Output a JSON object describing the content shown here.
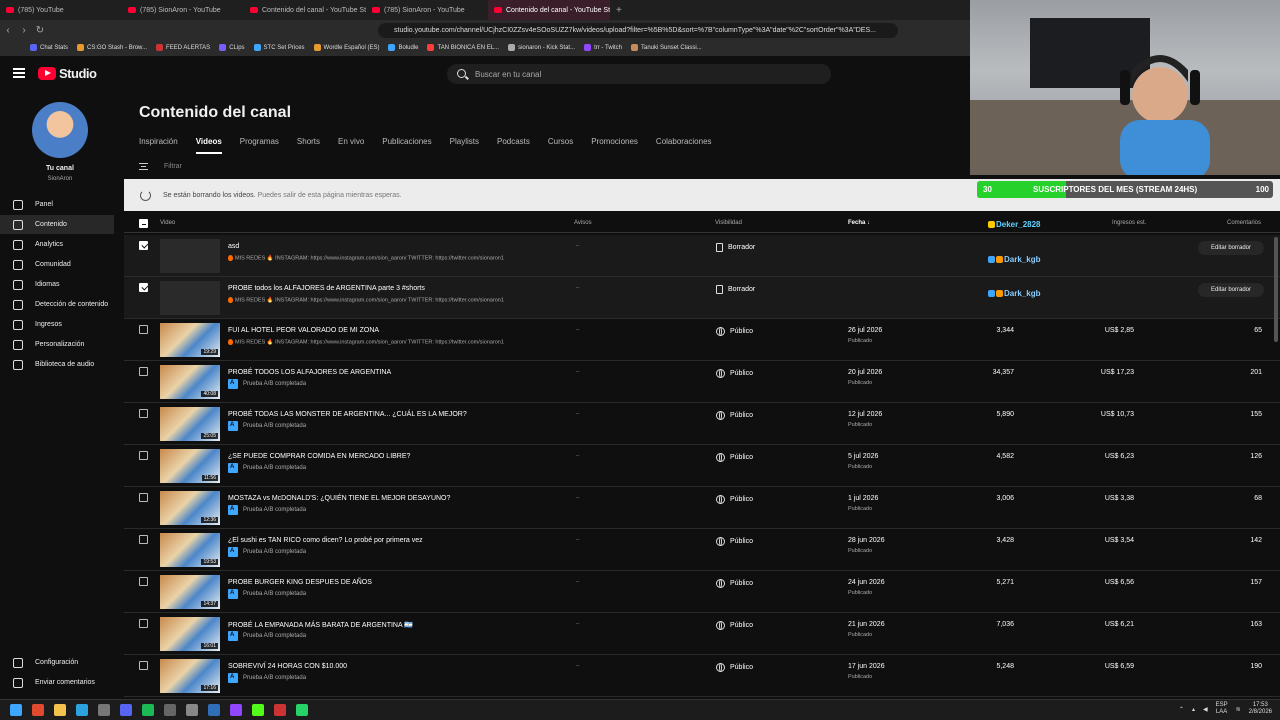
{
  "browser": {
    "tabs": [
      {
        "label": "(785) YouTube",
        "active": false
      },
      {
        "label": "(785) SionAron - YouTube",
        "active": false
      },
      {
        "label": "Contenido del canal - YouTube Studi",
        "active": false
      },
      {
        "label": "(785) SionAron - YouTube",
        "active": false
      },
      {
        "label": "Contenido del canal - YouTube Studio",
        "active": true
      }
    ],
    "url": "studio.youtube.com/channel/UCjhzCI0ZZsv4eSOoSUZZ7kw/videos/upload?filter=%5B%5D&sort=%7B\"columnType\"%3A\"date\"%2C\"sortOrder\"%3A\"DES...",
    "bookmarks": [
      "Chat Stats",
      "CS:GO Stash - Brow...",
      "FEED ALERTAS",
      "CLips",
      "STC Set Prices",
      "Wordle Español (ES)",
      "Boludle",
      "TAN BIONICA EN EL...",
      "sionaron - Kick Stat...",
      "trr - Twitch",
      "Tanuki Sunset Classi..."
    ]
  },
  "header": {
    "logo_text": "Studio",
    "search_placeholder": "Buscar en tu canal"
  },
  "sidebar": {
    "channel_label": "Tu canal",
    "channel_handle": "SionAron",
    "items": [
      {
        "label": "Panel",
        "icon": "dashboard-icon",
        "active": false
      },
      {
        "label": "Contenido",
        "icon": "content-icon",
        "active": true
      },
      {
        "label": "Analytics",
        "icon": "analytics-icon",
        "active": false
      },
      {
        "label": "Comunidad",
        "icon": "community-icon",
        "active": false
      },
      {
        "label": "Idiomas",
        "icon": "languages-icon",
        "active": false
      },
      {
        "label": "Detección de contenido",
        "icon": "detection-icon",
        "active": false
      },
      {
        "label": "Ingresos",
        "icon": "earn-icon",
        "active": false
      },
      {
        "label": "Personalización",
        "icon": "customization-icon",
        "active": false
      },
      {
        "label": "Biblioteca de audio",
        "icon": "audio-library-icon",
        "active": false
      }
    ],
    "footer": [
      {
        "label": "Configuración",
        "icon": "settings-icon"
      },
      {
        "label": "Enviar comentarios",
        "icon": "feedback-icon"
      }
    ]
  },
  "main": {
    "title": "Contenido del canal",
    "tabs": [
      "Inspiración",
      "Videos",
      "Programas",
      "Shorts",
      "En vivo",
      "Publicaciones",
      "Playlists",
      "Podcasts",
      "Cursos",
      "Promociones",
      "Colaboraciones"
    ],
    "active_tab": "Videos",
    "filter_placeholder": "Filtrar",
    "banner_text": "Se están borrando los videos.",
    "banner_extra": "Puedes salir de esta página mientras esperas."
  },
  "table": {
    "headers": {
      "video": "Video",
      "avisos": "Avisos",
      "visibilidad": "Visibilidad",
      "fecha": "Fecha",
      "ingresos": "Ingresos est.",
      "comentarios": "Comentarios"
    },
    "rows": [
      {
        "title": "asd",
        "desc": "MIS REDES 🔥 INSTAGRAM: https://www.instagram.com/sion_aaron/ TWITTER: https://twitter.com/sionaron1",
        "checked": true,
        "draft": true,
        "duration": "",
        "avisos": "–",
        "visibility": "Borrador",
        "date": "",
        "date_status": "",
        "views": "",
        "revenue": "",
        "comments": "",
        "edit_label": "Editar borrador"
      },
      {
        "title": "PROBE todos los ALFAJORES de ARGENTINA parte 3 #shorts",
        "desc": "MIS REDES 🔥 INSTAGRAM: https://www.instagram.com/sion_aaron/ TWITTER: https://twitter.com/sionaron1",
        "checked": true,
        "draft": true,
        "duration": "",
        "avisos": "–",
        "visibility": "Borrador",
        "date": "",
        "date_status": "",
        "views": "",
        "revenue": "",
        "comments": "",
        "edit_label": "Editar borrador"
      },
      {
        "title": "FUI AL HOTEL PEOR VALORADO DE MI ZONA",
        "desc": "MIS REDES 🔥 INSTAGRAM: https://www.instagram.com/sion_aaron/ TWITTER: https://twitter.com/sionaron1",
        "checked": false,
        "draft": false,
        "duration": "19:29",
        "avisos": "–",
        "visibility": "Público",
        "date": "26 jul 2026",
        "date_status": "Publicado",
        "views": "3,344",
        "revenue": "US$ 2,85",
        "comments": "65"
      },
      {
        "title": "PROBÉ TODOS LOS ALFAJORES DE ARGENTINA",
        "ab": "Prueba A/B completada",
        "checked": false,
        "draft": false,
        "duration": "40:08",
        "avisos": "–",
        "visibility": "Público",
        "date": "20 jul 2026",
        "date_status": "Publicado",
        "views": "34,357",
        "revenue": "US$ 17,23",
        "comments": "201"
      },
      {
        "title": "PROBÉ TODAS LAS MONSTER DE ARGENTINA... ¿CUÁL ES LA MEJOR?",
        "ab": "Prueba A/B completada",
        "checked": false,
        "draft": false,
        "duration": "25:05",
        "avisos": "–",
        "visibility": "Público",
        "date": "12 jul 2026",
        "date_status": "Publicado",
        "views": "5,890",
        "revenue": "US$ 10,73",
        "comments": "155"
      },
      {
        "title": "¿SE PUEDE COMPRAR COMIDA EN MERCADO LIBRE?",
        "ab": "Prueba A/B completada",
        "checked": false,
        "draft": false,
        "duration": "11:56",
        "avisos": "–",
        "visibility": "Público",
        "date": "5 jul 2026",
        "date_status": "Publicado",
        "views": "4,582",
        "revenue": "US$ 6,23",
        "comments": "126"
      },
      {
        "title": "MOSTAZA vs McDONALD'S: ¿QUIÉN TIENE EL MEJOR DESAYUNO?",
        "ab": "Prueba A/B completada",
        "checked": false,
        "draft": false,
        "duration": "12:36",
        "avisos": "–",
        "visibility": "Público",
        "date": "1 jul 2026",
        "date_status": "Publicado",
        "views": "3,006",
        "revenue": "US$ 3,38",
        "comments": "68"
      },
      {
        "title": "¿El sushi es TAN RICO como dicen? Lo probé por primera vez",
        "ab": "Prueba A/B completada",
        "checked": false,
        "draft": false,
        "duration": "19:53",
        "avisos": "–",
        "visibility": "Público",
        "date": "28 jun 2026",
        "date_status": "Publicado",
        "views": "3,428",
        "revenue": "US$ 3,54",
        "comments": "142"
      },
      {
        "title": "PROBE BURGER KING DESPUES DE AÑOS",
        "ab": "Prueba A/B completada",
        "checked": false,
        "draft": false,
        "duration": "14:37",
        "avisos": "–",
        "visibility": "Público",
        "date": "24 jun 2026",
        "date_status": "Publicado",
        "views": "5,271",
        "revenue": "US$ 6,56",
        "comments": "157"
      },
      {
        "title": "PROBÉ LA EMPANADA MÁS BARATA DE ARGENTINA 🇦🇷",
        "ab": "Prueba A/B completada",
        "checked": false,
        "draft": false,
        "duration": "16:01",
        "avisos": "–",
        "visibility": "Público",
        "date": "21 jun 2026",
        "date_status": "Publicado",
        "views": "7,036",
        "revenue": "US$ 6,21",
        "comments": "163"
      },
      {
        "title": "SOBREVIVÍ 24 HORAS CON $10.000",
        "ab": "Prueba A/B completada",
        "checked": false,
        "draft": false,
        "duration": "17:16",
        "avisos": "–",
        "visibility": "Público",
        "date": "17 jun 2026",
        "date_status": "Publicado",
        "views": "5,248",
        "revenue": "US$ 6,59",
        "comments": "190"
      }
    ]
  },
  "overlay": {
    "sub_goal": {
      "label": "SUSCRIPTORES DEL MES (STREAM 24HS)",
      "current": "30",
      "target": "100",
      "fraction": 0.3,
      "color": "#25d12a"
    },
    "chat_users": [
      "Deker_2828",
      "Dark_kgb",
      "Dark_kgb"
    ]
  },
  "taskbar": {
    "lang_top": "ESP",
    "lang_bottom": "LAA",
    "time": "17:53",
    "date": "2/8/2026"
  }
}
